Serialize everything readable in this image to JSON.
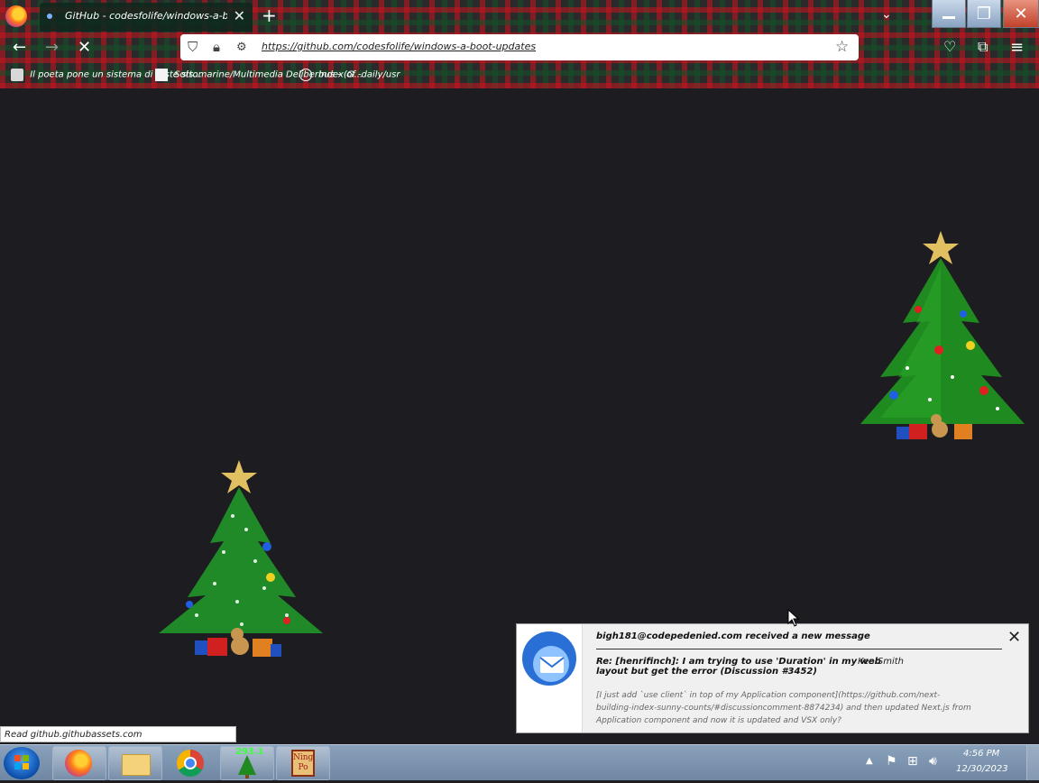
{
  "browser": {
    "tab_title": "GitHub - codesfolife/windows-a-boot-updates: Windows",
    "url": "https://github.com/codesfolife/windows-a-boot-updates",
    "bookmarks": [
      {
        "label": "Il poeta pone un sistema di teste sis...",
        "icon": "book-icon"
      },
      {
        "label": "Sottomarine/Multimedia Deliberbus - (G...",
        "icon": "page-icon"
      },
      {
        "label": "Index of -daily/usr",
        "icon": "globe-icon"
      }
    ],
    "status_url": "Read github.githubassets.com"
  },
  "notification": {
    "sender": "bigh181@codepedenied.com received a new message",
    "subject": "Re: [henrifinch]: I am trying to use 'Duration' in my web layout but get the error (Discussion #3452)",
    "author": "Ken Smith",
    "body": "[I just add `use client` in top of my Application component](https://github.com/next-building-index-sunny-counts/#discussioncomment-8874234) and then updated Next.js from Application component and now it is updated and VSX only?"
  },
  "taskbar": {
    "apps": [
      {
        "name": "firefox-taskbar-button",
        "icon": "firefox-icon"
      },
      {
        "name": "explorer-taskbar-button",
        "icon": "folder-icon"
      },
      {
        "name": "chrome-taskbar-button",
        "icon": "chrome-icon"
      },
      {
        "name": "tree-taskbar-button",
        "icon": "christmas-tree-icon",
        "badge": "293.1"
      },
      {
        "name": "ningpo-taskbar-button",
        "icon": "ningpo-icon",
        "label": "Ning Po"
      }
    ],
    "clock_time": "4:56 PM",
    "clock_date": "12/30/2023"
  },
  "colors": {
    "content_bg": "#1d1c21",
    "taskbar": "#7890aa",
    "close_button": "#c2412b"
  }
}
